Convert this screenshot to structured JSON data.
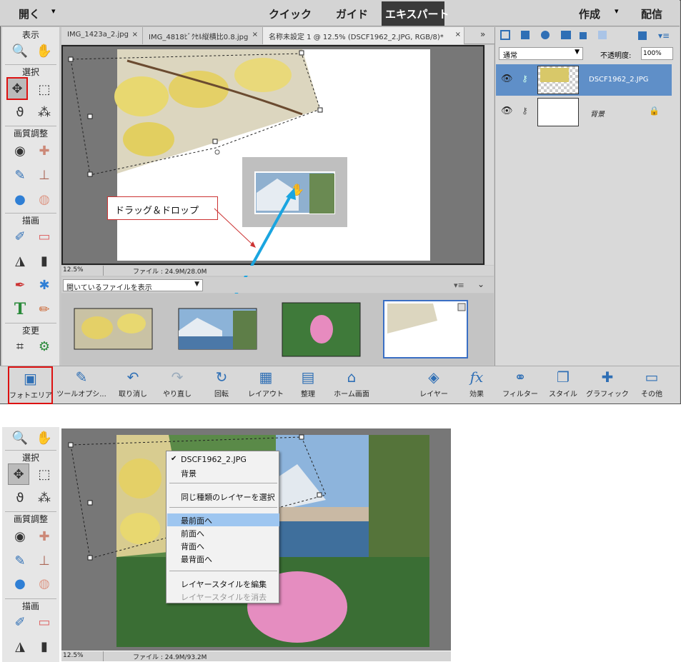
{
  "topbar": {
    "open": "開く",
    "quick": "クイック",
    "guide": "ガイド",
    "expert": "エキスパート",
    "create": "作成",
    "share": "配信",
    "dropdown_glyph": "▾"
  },
  "toolbox": {
    "sections": {
      "view": "表示",
      "select": "選択",
      "enhance": "画質調整",
      "draw": "描画",
      "modify": "変更"
    },
    "tool_icons": {
      "zoom": "🔍",
      "hand": "✋",
      "move": "✥",
      "marquee": "⬚",
      "lasso": "ϑ",
      "quick_select": "⁂",
      "red_eye": "◉",
      "spot_healing": "✚",
      "smart_brush": "✎",
      "clone_stamp": "⊥",
      "blur": "●",
      "sponge": "◍",
      "brush": "✐",
      "eraser": "▭",
      "paint_bucket": "◮",
      "gradient": "▮",
      "eyedropper": "✒",
      "custom_shape": "✱",
      "type": "T",
      "pencil": "✏",
      "crop": "⌗",
      "recompose": "⚙"
    }
  },
  "tabs": [
    "IMG_1423a_2.jpg",
    "IMG_4818ﾋﾞｸｾﾙ縦横比0.8.jpg",
    "名称未設定 1 @ 12.5% (DSCF1962_2.JPG, RGB/8)*"
  ],
  "tab_close": "×",
  "tab_more": "»",
  "status": {
    "zoom": "12.5%",
    "file": "ファイル : 24.9M/28.0M"
  },
  "bin": {
    "dropdown": "開いているファイルを表示"
  },
  "annotation": {
    "label": "ドラッグ＆ドロップ"
  },
  "layers": {
    "blend_mode": "通常",
    "opacity_label": "不透明度:",
    "opacity": "100%",
    "items": [
      {
        "name": "DSCF1962_2.JPG"
      },
      {
        "name": "背景"
      }
    ]
  },
  "bottombar": [
    {
      "label": "フォトエリア",
      "icon": "▣"
    },
    {
      "label": "ツールオプシ...",
      "icon": "✎"
    },
    {
      "label": "取り消し",
      "icon": "↶"
    },
    {
      "label": "やり直し",
      "icon": "↷"
    },
    {
      "label": "回転",
      "icon": "↻"
    },
    {
      "label": "レイアウト",
      "icon": "▦"
    },
    {
      "label": "整理",
      "icon": "▤"
    },
    {
      "label": "ホーム画面",
      "icon": "⌂"
    },
    {
      "label": "レイヤー",
      "icon": "◈"
    },
    {
      "label": "効果",
      "icon": "fx"
    },
    {
      "label": "フィルター",
      "icon": "⚭"
    },
    {
      "label": "スタイル",
      "icon": "❐"
    },
    {
      "label": "グラフィック",
      "icon": "✚"
    },
    {
      "label": "その他",
      "icon": "▭"
    }
  ],
  "status2": {
    "zoom": "12.5%",
    "file": "ファイル : 24.9M/93.2M"
  },
  "context_menu": {
    "items": [
      "DSCF1962_2.JPG",
      "背景",
      "同じ種類のレイヤーを選択",
      "最前面へ",
      "前面へ",
      "背面へ",
      "最背面へ",
      "レイヤースタイルを編集",
      "レイヤースタイルを消去"
    ],
    "check": "✔"
  }
}
